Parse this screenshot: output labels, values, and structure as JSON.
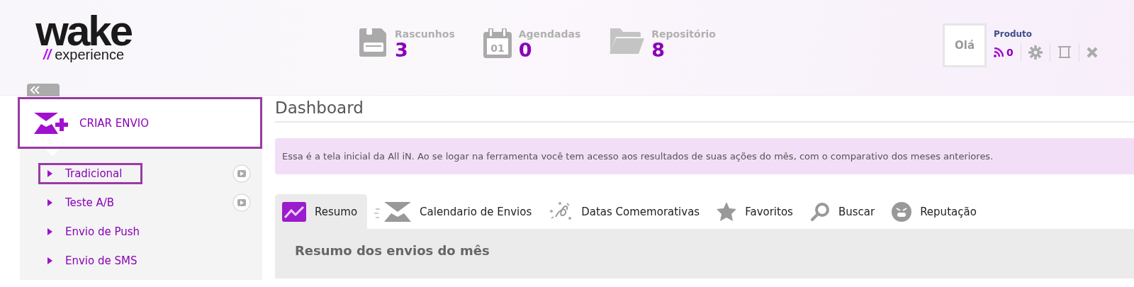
{
  "logo": {
    "wordmark": "wake",
    "slashes": "//",
    "tagline": "experience"
  },
  "stats": [
    {
      "kind": "drafts",
      "label": "Rascunhos",
      "count": "3"
    },
    {
      "kind": "scheduled",
      "label": "Agendadas",
      "count": "0",
      "day": "01"
    },
    {
      "kind": "repository",
      "label": "Repositório",
      "count": "8"
    }
  ],
  "user": {
    "greeting": "Olá",
    "product": "Produto",
    "feed_count": "0"
  },
  "sidebar": {
    "create_label": "CRIAR ENVIO",
    "items": [
      {
        "label": "Tradicional",
        "selected": true,
        "video": true
      },
      {
        "label": "Teste A/B",
        "selected": false,
        "video": true
      },
      {
        "label": "Envio de Push",
        "selected": false,
        "video": false
      },
      {
        "label": "Envio de SMS",
        "selected": false,
        "video": false
      }
    ]
  },
  "page_title": "Dashboard",
  "info_banner": "Essa é a tela inicial da All iN. Ao se logar na ferramenta você tem acesso aos resultados de suas ações do mês, com o comparativo dos meses anteriores.",
  "tabs": [
    {
      "kind": "summary",
      "label": "Resumo",
      "selected": true
    },
    {
      "kind": "calendar",
      "label": "Calendario de Envios",
      "selected": false
    },
    {
      "kind": "dates",
      "label": "Datas Comemorativas",
      "selected": false
    },
    {
      "kind": "favorites",
      "label": "Favoritos",
      "selected": false
    },
    {
      "kind": "search",
      "label": "Buscar",
      "selected": false
    },
    {
      "kind": "reputation",
      "label": "Reputação",
      "selected": false
    }
  ],
  "panel_title": "Resumo dos envios do mês"
}
